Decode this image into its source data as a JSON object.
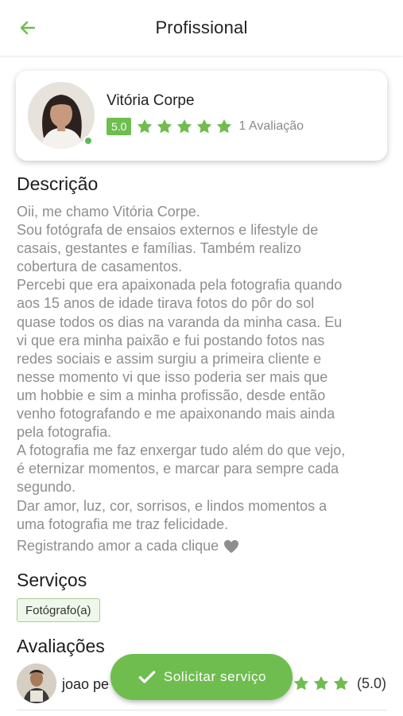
{
  "header": {
    "title": "Profissional",
    "back_icon": "arrow-left-icon"
  },
  "colors": {
    "accent": "#6fbd4f",
    "text_muted": "#8e8e8e",
    "online": "#5cb85c"
  },
  "profile": {
    "name": "Vitória Corpe",
    "rating": "5.0",
    "stars": 5,
    "review_count": "1 Avaliação",
    "online": true
  },
  "description": {
    "title": "Descrição",
    "lines": [
      "Oii, me chamo Vitória Corpe.",
      "Sou fotógrafa de ensaios externos e lifestyle de",
      "casais, gestantes e famílias. Também realizo",
      "cobertura de casamentos.",
      "Percebi que era apaixonada pela fotografia quando",
      "aos 15 anos de idade tirava fotos do pôr do sol",
      "quase todos os dias na varanda da minha casa. Eu",
      "vi que era minha paixão e fui postando fotos nas",
      "redes sociais e assim surgiu a primeira cliente e",
      "nesse momento vi que isso poderia ser mais que",
      "um hobbie e sim a minha profissão, desde então",
      "venho fotografando e me apaixonando mais ainda",
      "pela fotografia.",
      "A fotografia me faz enxergar tudo além do que vejo,",
      "é eternizar momentos, e marcar para sempre cada",
      "segundo.",
      "Dar amor, luz, cor, sorrisos, e lindos momentos a",
      "uma fotografia me traz felicidade."
    ],
    "last_line": "Registrando amor a cada clique",
    "last_icon": "heart-icon"
  },
  "services": {
    "title": "Serviços",
    "items": [
      "Fotógrafo(a)"
    ]
  },
  "reviews": {
    "title": "Avaliações",
    "items": [
      {
        "name": "joao pe",
        "score": "(5.0)",
        "stars": 5
      }
    ]
  },
  "cta": {
    "label": "Solicitar serviço",
    "icon": "check-icon"
  }
}
